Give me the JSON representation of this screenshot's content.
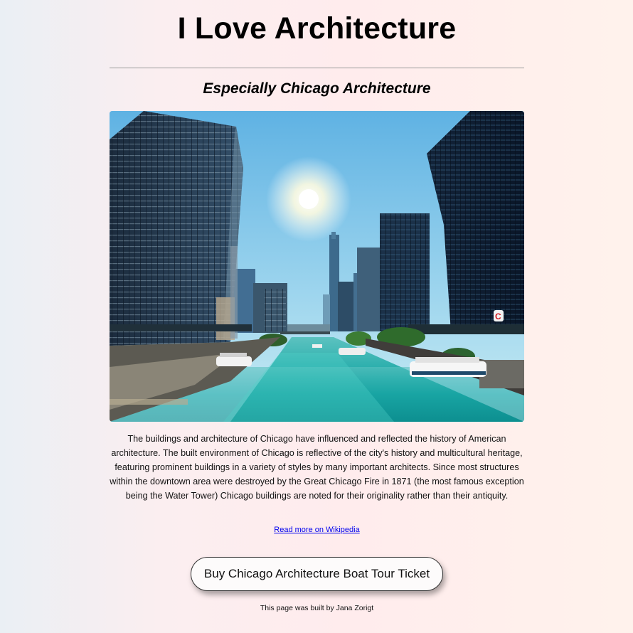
{
  "header": {
    "title": "I Love Architecture",
    "subtitle": "Especially Chicago Architecture"
  },
  "main": {
    "image_description_icon": "chicago-river-photo",
    "description": "The buildings and architecture of Chicago have influenced and reflected the history of American architecture. The built environment of Chicago is reflective of the city's history and multicultural heritage, featuring prominent buildings in a variety of styles by many important architects. Since most structures within the downtown area were destroyed by the Great Chicago Fire in 1871 (the most famous exception being the Water Tower) Chicago buildings are noted for their originality rather than their antiquity.",
    "link_text": "Read more on Wikipedia",
    "button_label": "Buy Chicago Architecture Boat Tour Ticket"
  },
  "footer": {
    "text": "This page was built by Jana Zorigt"
  },
  "colors": {
    "link": "#0000ee",
    "divider": "#9a9a9a",
    "sky": "#6db8df",
    "water": "#1fa6a6"
  }
}
